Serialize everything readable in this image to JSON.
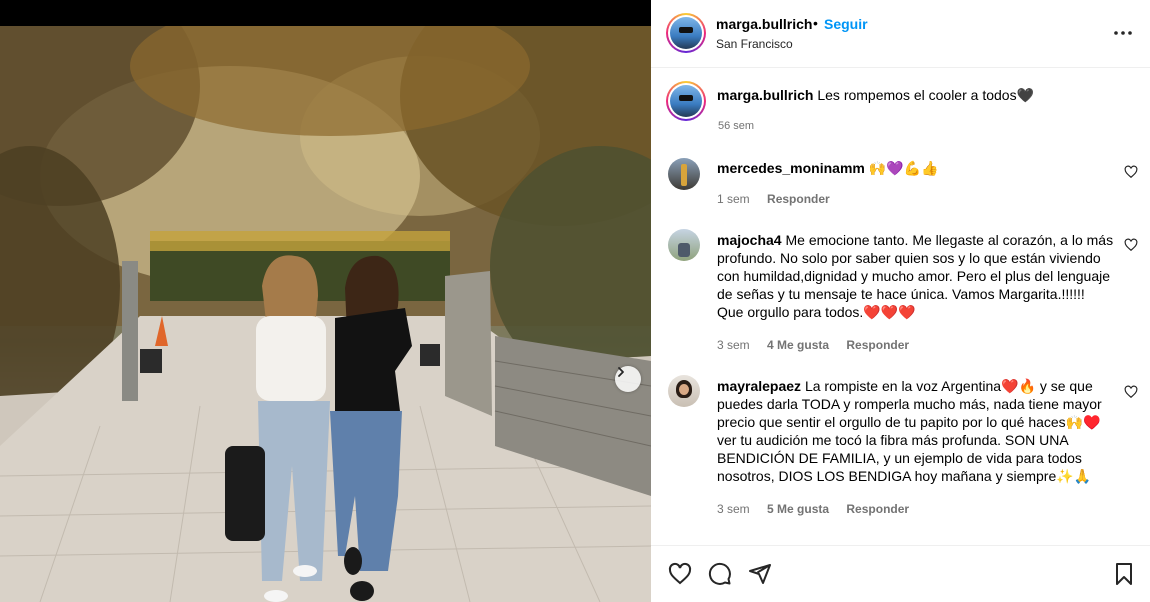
{
  "post": {
    "username": "marga.bullrich",
    "separator": "•",
    "follow_label": "Seguir",
    "location": "San Francisco",
    "more_icon": "more-horizontal-icon"
  },
  "caption": {
    "username": "marga.bullrich",
    "text": "Les rompemos el cooler a todos🖤",
    "time": "56 sem"
  },
  "comments": [
    {
      "username": "mercedes_moninamm",
      "text": "🙌💜💪👍",
      "time": "1 sem",
      "likes": "",
      "reply": "Responder"
    },
    {
      "username": "majocha4",
      "text": "Me emocione tanto. Me llegaste al corazón, a lo más profundo. No solo por saber quien sos y lo que están viviendo con humildad,dignidad y mucho amor. Pero el plus del lenguaje de señas y tu mensaje te hace única. Vamos Margarita.!!!!!! Que orgullo para todos.❤️❤️❤️",
      "time": "3 sem",
      "likes": "4 Me gusta",
      "reply": "Responder"
    },
    {
      "username": "mayralepaez",
      "text": "La rompiste en la voz Argentina❤️🔥 y se que puedes darla TODA y romperla mucho más, nada tiene mayor precio que sentir el orgullo de tu papito por lo qué haces🙌♥️ ver tu audición me tocó la fibra más profunda. SON UNA BENDICIÓN DE FAMILIA, y un ejemplo de vida para todos nosotros, DIOS LOS BENDIGA hoy mañana y siempre✨🙏",
      "time": "3 sem",
      "likes": "5 Me gusta",
      "reply": "Responder"
    }
  ],
  "icons": {
    "like": "heart-icon",
    "comment": "comment-icon",
    "share": "send-icon",
    "save": "bookmark-icon",
    "next": "chevron-right-icon"
  },
  "colors": {
    "accent": "#0095f6",
    "muted": "#737373",
    "divider": "#efefef"
  }
}
